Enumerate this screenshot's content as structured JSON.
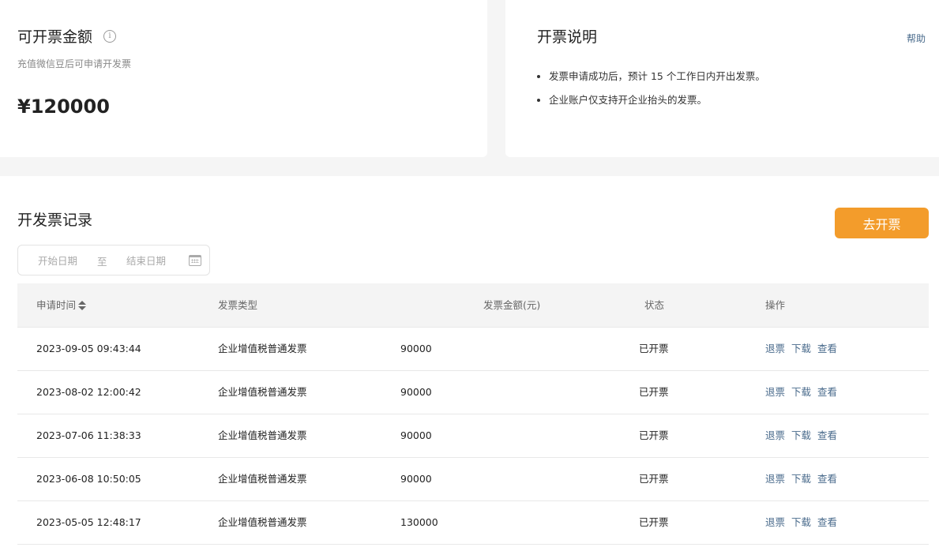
{
  "available": {
    "title": "可开票金额",
    "info_icon": "info-icon",
    "subtitle": "充值微信豆后可申请开发票",
    "amount": "¥120000"
  },
  "instructions": {
    "title": "开票说明",
    "help_label": "帮助",
    "notes": [
      "发票申请成功后，预计 15 个工作日内开出发票。",
      "企业账户仅支持开企业抬头的发票。"
    ]
  },
  "records": {
    "title": "开发票记录",
    "issue_button": "去开票",
    "date_range": {
      "start_placeholder": "开始日期",
      "separator": "至",
      "end_placeholder": "结束日期",
      "icon": "calendar-icon"
    },
    "columns": {
      "time": "申请时间",
      "type": "发票类型",
      "amount": "发票金额(元)",
      "status": "状态",
      "actions": "操作"
    },
    "rows": [
      {
        "time": "2023-09-05 09:43:44",
        "type": "企业增值税普通发票",
        "amount": "90000",
        "status": "已开票",
        "actions": [
          "退票",
          "下载",
          "查看"
        ]
      },
      {
        "time": "2023-08-02 12:00:42",
        "type": "企业增值税普通发票",
        "amount": "90000",
        "status": "已开票",
        "actions": [
          "退票",
          "下载",
          "查看"
        ]
      },
      {
        "time": "2023-07-06 11:38:33",
        "type": "企业增值税普通发票",
        "amount": "90000",
        "status": "已开票",
        "actions": [
          "退票",
          "下载",
          "查看"
        ]
      },
      {
        "time": "2023-06-08 10:50:05",
        "type": "企业增值税普通发票",
        "amount": "90000",
        "status": "已开票",
        "actions": [
          "退票",
          "下载",
          "查看"
        ]
      },
      {
        "time": "2023-05-05 12:48:17",
        "type": "企业增值税普通发票",
        "amount": "130000",
        "status": "已开票",
        "actions": [
          "退票",
          "下载",
          "查看"
        ]
      }
    ]
  },
  "colors": {
    "accent": "#f39c2b",
    "link": "#4a6b8c",
    "background": "#f5f5f5"
  }
}
